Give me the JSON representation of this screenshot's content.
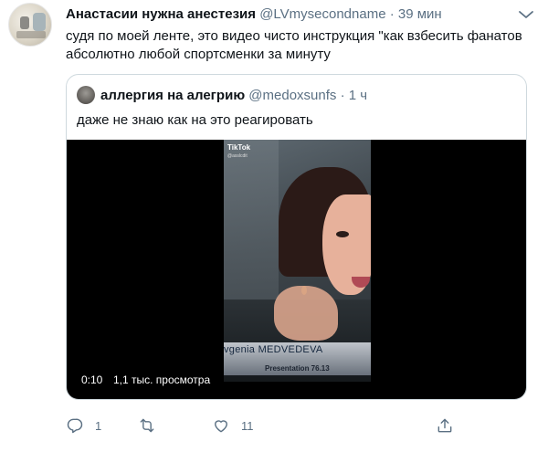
{
  "tweet": {
    "author_name": "Анастасии нужна анестезия",
    "author_handle": "@LVmysecondname",
    "separator": "·",
    "time": "39 мин",
    "text": "судя по моей ленте, это видео чисто инструкция \"как взбесить фанатов абсолютно любой спортсменки за минуту",
    "avatar_icon": "avatar-image",
    "more_icon": "more-icon"
  },
  "quoted": {
    "author_name": "аллергия на алегрию",
    "author_handle": "@medoxsunfs",
    "separator": "·",
    "time": "1 ч",
    "text": "даже не знаю как на это реагировать",
    "video": {
      "tiktok_logo": "TikTok",
      "tiktok_user": "@asslcdit",
      "banner_name": "vgenia MEDVEDEVA",
      "banner_sub": "Presentation 76.13",
      "duration": "0:10",
      "views": "1,1 тыс. просмотра"
    }
  },
  "actions": {
    "reply_count": "1",
    "retweet_count": "",
    "like_count": "11",
    "icons": [
      "reply-icon",
      "retweet-icon",
      "like-icon",
      "share-icon"
    ]
  },
  "colors": {
    "text_primary": "#0f1419",
    "text_secondary": "#5b7083",
    "border": "#cfd9de",
    "background": "#ffffff"
  }
}
